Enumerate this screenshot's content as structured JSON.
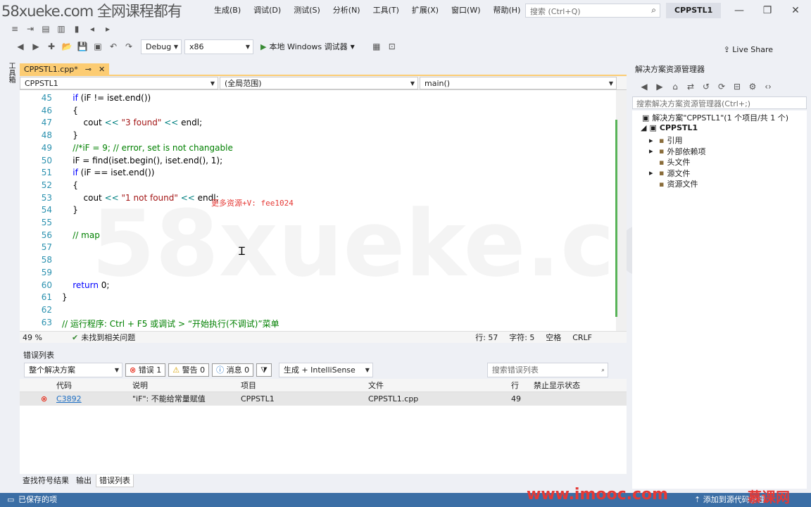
{
  "top_watermark": "58xueke.com 全网课程都有",
  "menu": [
    "生成(B)",
    "调试(D)",
    "测试(S)",
    "分析(N)",
    "工具(T)",
    "扩展(X)",
    "窗口(W)",
    "帮助(H)"
  ],
  "search_placeholder": "搜索 (Ctrl+Q)",
  "solution_name_badge": "CPPSTL1",
  "live_share": "Live Share",
  "toolbar": {
    "config": "Debug",
    "platform": "x86",
    "run_label": "本地 Windows 调试器"
  },
  "left_strip_label": "工具箱",
  "editor": {
    "tab_title": "CPPSTL1.cpp*",
    "nav_project": "CPPSTL1",
    "nav_scope": "(全局范围)",
    "nav_function": "main()",
    "zoom": "49 %",
    "issues": "未找到相关问题",
    "row": "行: 57",
    "col": "字符: 5",
    "spaces": "空格",
    "eol": "CRLF",
    "lines": [
      {
        "n": "45",
        "html": "    <span class='kw'>if</span> (iF != iset.end())"
      },
      {
        "n": "46",
        "html": "    {"
      },
      {
        "n": "47",
        "html": "        cout <span class='op'>&lt;&lt;</span> <span class='st'>\"3 found\"</span> <span class='op'>&lt;&lt;</span> endl;"
      },
      {
        "n": "48",
        "html": "    }"
      },
      {
        "n": "49",
        "html": "    <span class='cm'>//*iF = 9; // error, set is not changable</span>"
      },
      {
        "n": "50",
        "html": "    iF = find(iset.begin(), iset.end(), 1);"
      },
      {
        "n": "51",
        "html": "    <span class='kw'>if</span> (iF == iset.end())"
      },
      {
        "n": "52",
        "html": "    {"
      },
      {
        "n": "53",
        "html": "        cout <span class='op'>&lt;&lt;</span> <span class='st'>\"1 not found\"</span> <span class='op'>&lt;&lt;</span> endl;"
      },
      {
        "n": "54",
        "html": "    }"
      },
      {
        "n": "55",
        "html": ""
      },
      {
        "n": "56",
        "html": "    <span class='cm'>// map</span>"
      },
      {
        "n": "57",
        "html": ""
      },
      {
        "n": "58",
        "html": ""
      },
      {
        "n": "59",
        "html": ""
      },
      {
        "n": "60",
        "html": "    <span class='kw'>return</span> 0;"
      },
      {
        "n": "61",
        "html": "}"
      },
      {
        "n": "62",
        "html": ""
      },
      {
        "n": "63",
        "html": "<span class='cm'>// 运行程序: Ctrl + F5 或调试 &gt; “开始执行(不调试)”菜单</span>"
      }
    ]
  },
  "inline_watermark": "更多资源+V: fee1024",
  "bg_watermark": "58xueke.com",
  "error_list": {
    "title": "错误列表",
    "scope": "整个解决方案",
    "errors_btn": "错误 1",
    "warnings_btn": "警告 0",
    "messages_btn": "消息 0",
    "build_filter": "生成 + IntelliSense",
    "search_placeholder": "搜索错误列表",
    "headers": {
      "code": "代码",
      "desc": "说明",
      "project": "项目",
      "file": "文件",
      "line": "行",
      "suppress": "禁止显示状态"
    },
    "row": {
      "code": "C3892",
      "desc": "\"iF\": 不能给常量赋值",
      "project": "CPPSTL1",
      "file": "CPPSTL1.cpp",
      "line": "49"
    }
  },
  "bottom_tabs": [
    "查找符号结果",
    "输出",
    "错误列表"
  ],
  "solution_explorer": {
    "title": "解决方案资源管理器",
    "search_placeholder": "搜索解决方案资源管理器(Ctrl+;)",
    "solution": "解决方案\"CPPSTL1\"(1 个项目/共 1 个)",
    "project": "CPPSTL1",
    "items": [
      "引用",
      "外部依赖项",
      "头文件",
      "源文件",
      "资源文件"
    ]
  },
  "status": {
    "saved": "已保存的项",
    "add_source": "添加到源代码管理"
  },
  "imooc": "www.imooc.com",
  "imooc_cn": "慕课网"
}
